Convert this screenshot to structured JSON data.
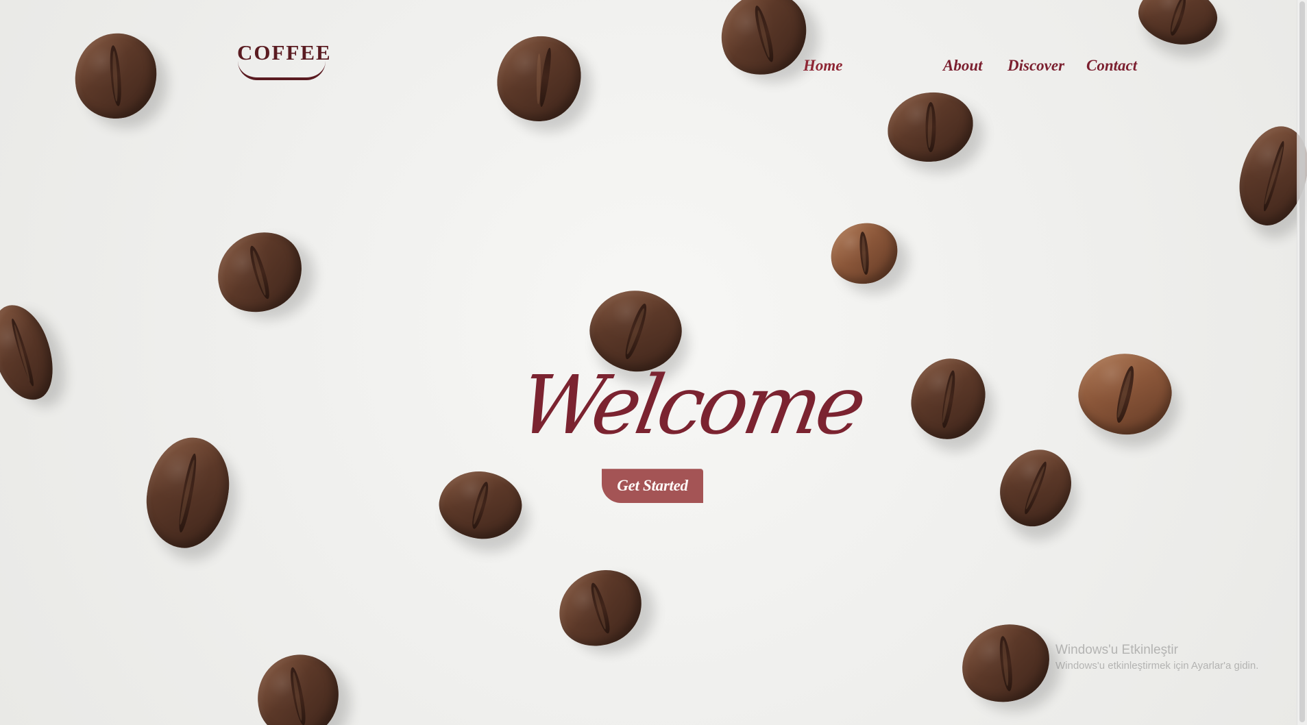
{
  "brand": {
    "logo_text": "COFFEE"
  },
  "nav": {
    "items": [
      {
        "label": "Home"
      },
      {
        "label": "About"
      },
      {
        "label": "Discover"
      },
      {
        "label": "Contact"
      }
    ]
  },
  "hero": {
    "title": "Welcome",
    "button_label": "Get Started"
  },
  "system_notice": {
    "title": "Windows'u Etkinleştir",
    "subtitle": "Windows'u etkinleştirmek için Ayarlar'a gidin."
  },
  "colors": {
    "primary": "#7b2330",
    "button": "#a45455",
    "background": "#f1f1ef"
  },
  "icons": {
    "coffee_bean": "coffee-bean-icon"
  }
}
